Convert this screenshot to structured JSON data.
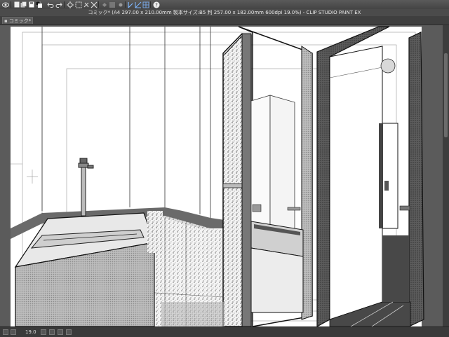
{
  "window": {
    "title": "コミック* (A4 297.00 x 210.00mm 製本サイズ:B5 判 257.00 x 182.00mm 600dpi 19.0%)  - CLIP STUDIO PAINT EX"
  },
  "toolbar": {
    "icons": [
      "view-icon",
      "new-file-icon",
      "open-file-icon",
      "color-swatch-icon",
      "undo-icon",
      "redo-icon",
      "transform-icon",
      "move-icon",
      "cut-icon",
      "clear-icon",
      "fill-icon",
      "ruler-icon",
      "snap-icon",
      "grid-icon",
      "help-icon"
    ]
  },
  "tabs": [
    {
      "label": "コミック*"
    }
  ],
  "status": {
    "zoom": "19.0"
  },
  "colors": {
    "chrome_dark": "#3a3a3a",
    "canvas_bg": "#5b5b5b",
    "paper": "#ffffff",
    "ink": "#1a1a1a",
    "wall_stripe": "#6a6a6a"
  }
}
